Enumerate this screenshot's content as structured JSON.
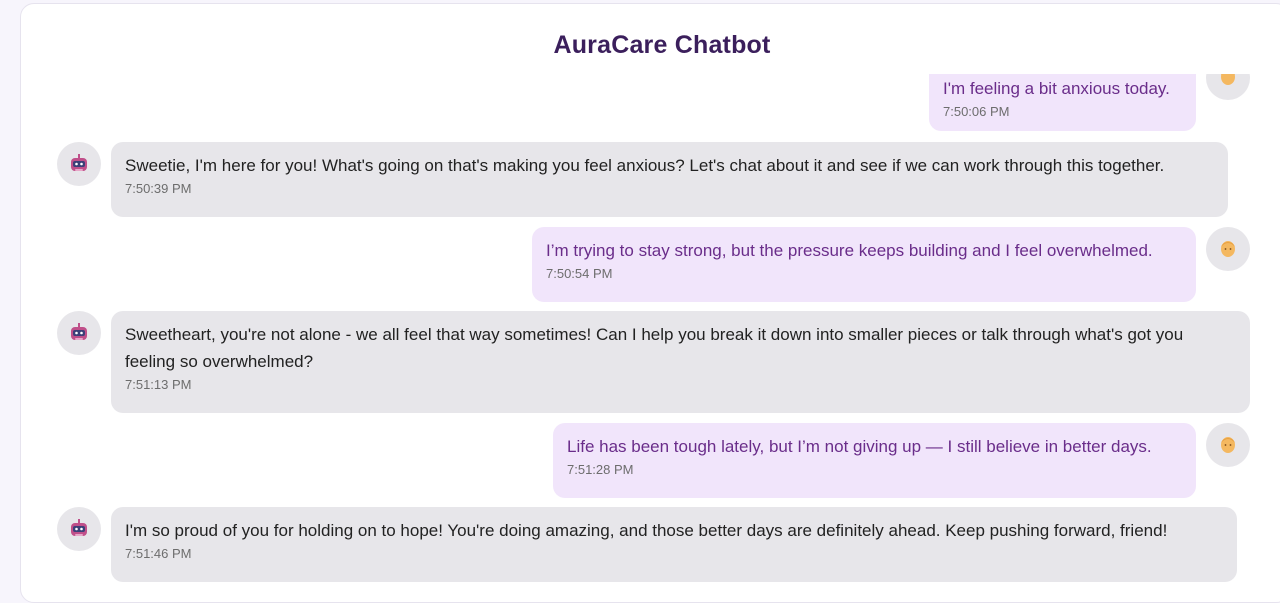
{
  "header": {
    "title": "AuraCare Chatbot"
  },
  "messages": [
    {
      "sender": "user",
      "text": "I'm feeling a bit anxious today.",
      "time": "7:50:06 PM"
    },
    {
      "sender": "bot",
      "text": "Sweetie, I'm here for you! What's going on that's making you feel anxious? Let's chat about it and see if we can work through this together.",
      "time": "7:50:39 PM"
    },
    {
      "sender": "user",
      "text": "I’m trying to stay strong, but the pressure keeps building and I feel overwhelmed.",
      "time": "7:50:54 PM"
    },
    {
      "sender": "bot",
      "text": "Sweetheart, you're not alone - we all feel that way sometimes! Can I help you break it down into smaller pieces or talk through what's got you feeling so overwhelmed?",
      "time": "7:51:13 PM"
    },
    {
      "sender": "user",
      "text": "Life has been tough lately, but I’m not giving up — I still believe in better days.",
      "time": "7:51:28 PM"
    },
    {
      "sender": "bot",
      "text": "I'm so proud of you for holding on to hope! You're doing amazing, and those better days are definitely ahead. Keep pushing forward, friend!",
      "time": "7:51:46 PM"
    }
  ],
  "icons": {
    "bot_avatar": "robot-icon",
    "user_avatar": "person-icon",
    "scroll_up": "arrow-up-icon"
  },
  "colors": {
    "title": "#3b1f5c",
    "bot_bubble": "#e7e6ea",
    "user_bubble": "#f1e5fb",
    "user_text": "#6a2d8a"
  }
}
